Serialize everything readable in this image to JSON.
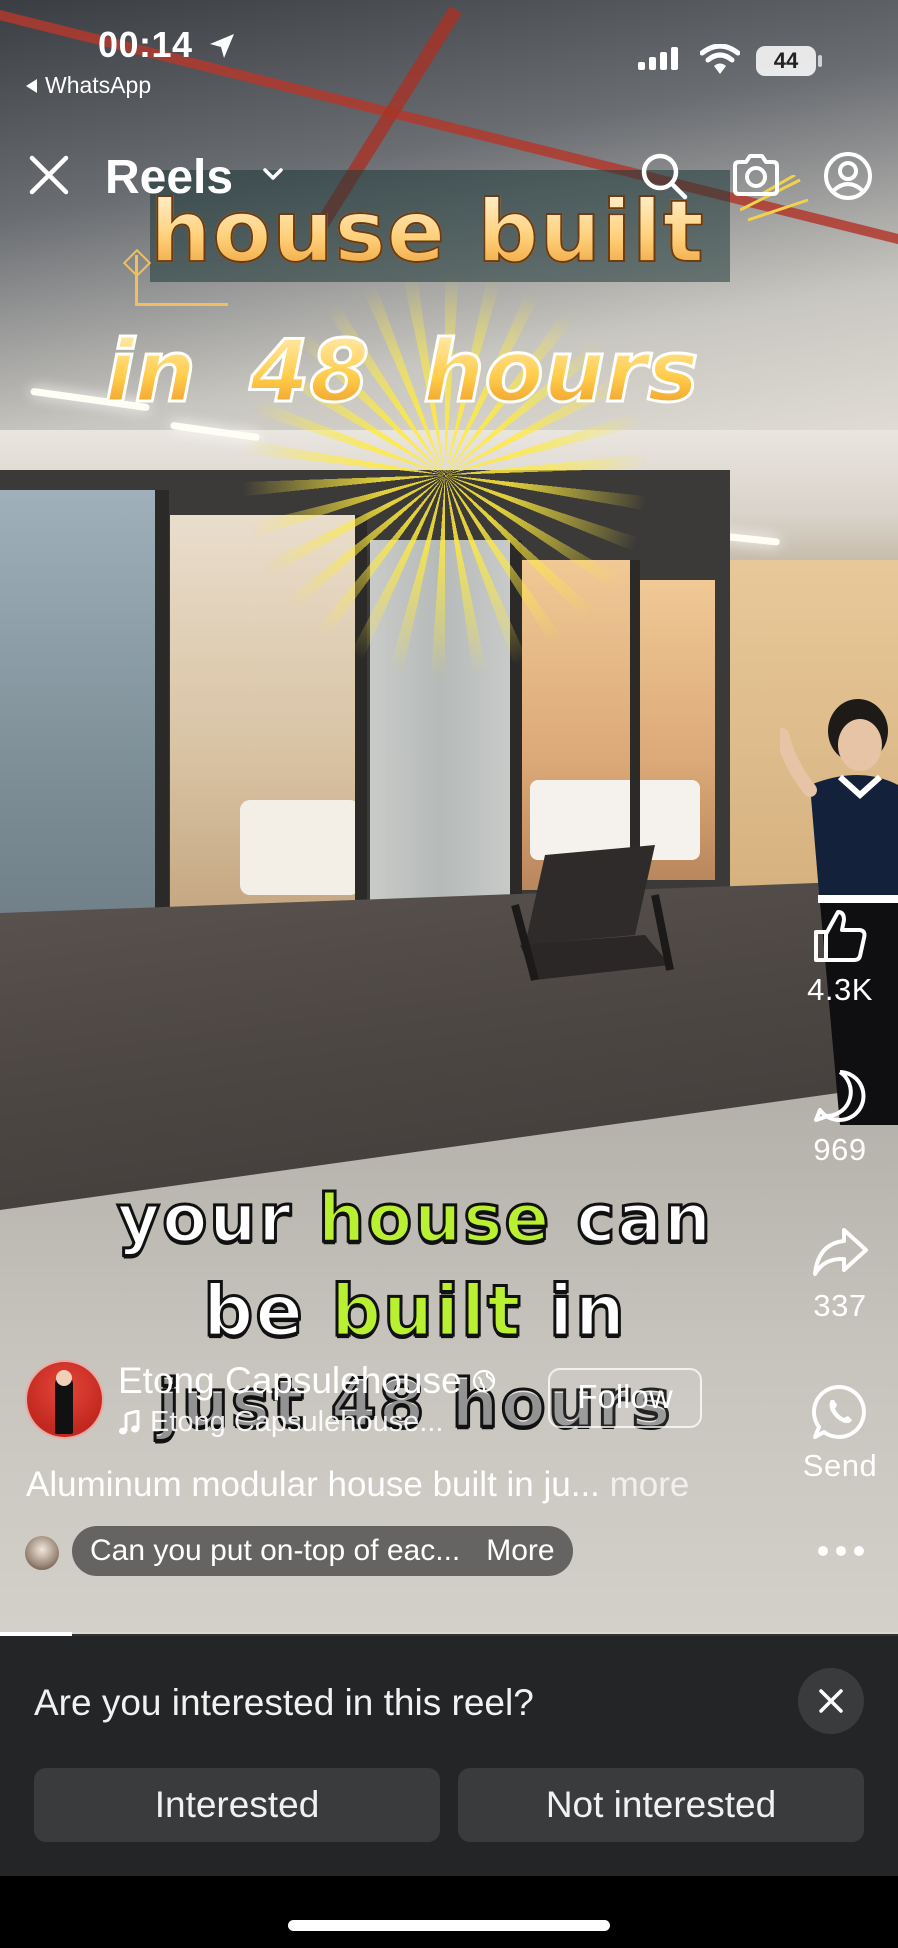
{
  "status_bar": {
    "time": "00:14",
    "back_app": "WhatsApp",
    "battery": "44"
  },
  "header": {
    "title": "Reels"
  },
  "video_overlay": {
    "headline_line1": "house built",
    "headline_line2": "in 48 hours",
    "caption_line1_a": "your ",
    "caption_line1_hl": "house",
    "caption_line1_b": " can",
    "caption_line2_a": "be ",
    "caption_line2_hl": "built",
    "caption_line2_b": " in",
    "caption_line3": "just 48 hours"
  },
  "actions": {
    "likes": "4.3K",
    "comments": "969",
    "shares": "337",
    "send_label": "Send"
  },
  "author": {
    "name": "Etong Capsulehouse",
    "audio": "Etong Capsulehouse...",
    "follow_label": "Follow"
  },
  "description": {
    "text": "Aluminum modular house built in ju...",
    "more_label": "more"
  },
  "comment": {
    "text": "Can you put on-top of eac...",
    "more_label": "More"
  },
  "playback": {
    "progress_fraction": 0.08
  },
  "prompt": {
    "question": "Are you interested in this reel?",
    "interested_label": "Interested",
    "not_interested_label": "Not interested"
  },
  "colors": {
    "caption_highlight": "#b9f032",
    "panel_bg": "#242526",
    "button_bg": "#3a3b3c"
  }
}
